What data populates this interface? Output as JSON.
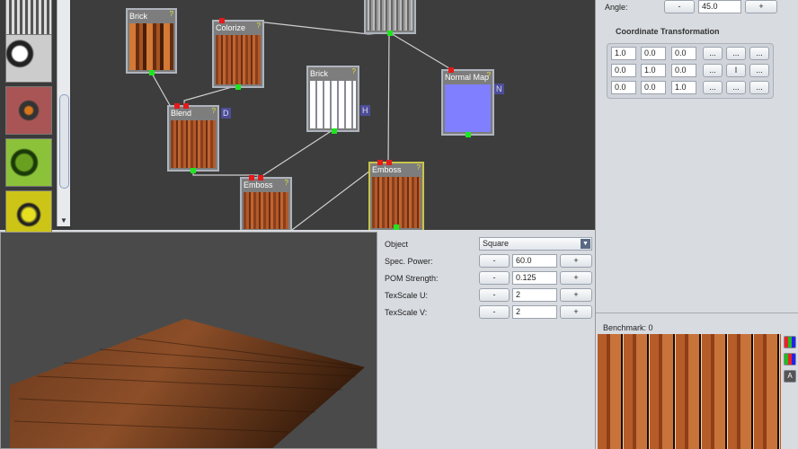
{
  "graph": {
    "nodes": [
      {
        "label": "Brick",
        "help": "?"
      },
      {
        "label": "Colorize",
        "help": "?"
      },
      {
        "label": "Blend",
        "help": "?",
        "tag": "D"
      },
      {
        "label": "Brick",
        "help": "?",
        "tag": "H"
      },
      {
        "label": "Normal Map",
        "help": "?",
        "tag": "N"
      },
      {
        "label": "Emboss",
        "help": "?"
      },
      {
        "label": "Emboss",
        "help": "?"
      }
    ]
  },
  "properties": {
    "object_label": "Object",
    "object_value": "Square",
    "rows": [
      {
        "label": "Spec. Power:",
        "value": "60.0",
        "minus": "-",
        "plus": "+"
      },
      {
        "label": "POM Strength:",
        "value": "0.125",
        "minus": "-",
        "plus": "+"
      },
      {
        "label": "TexScale U:",
        "value": "2",
        "minus": "-",
        "plus": "+"
      },
      {
        "label": "TexScale V:",
        "value": "2",
        "minus": "-",
        "plus": "+"
      }
    ]
  },
  "right": {
    "angle_label": "Angle:",
    "angle_value": "45.0",
    "minus": "-",
    "plus": "+",
    "coord_title": "Coordinate Transformation",
    "matrix": [
      [
        "1.0",
        "0.0",
        "0.0"
      ],
      [
        "0.0",
        "1.0",
        "0.0"
      ],
      [
        "0.0",
        "0.0",
        "1.0"
      ]
    ],
    "matrix_buttons": [
      [
        "...",
        "...",
        "..."
      ],
      [
        "...",
        "I",
        "..."
      ],
      [
        "...",
        "...",
        "..."
      ]
    ],
    "benchmark": "Benchmark: 0"
  },
  "colors": {
    "graph_bg": "#3d3d3d",
    "input_port": "#e31b1b",
    "output_port": "#1ee61e",
    "panel": "#d8dbe0"
  }
}
